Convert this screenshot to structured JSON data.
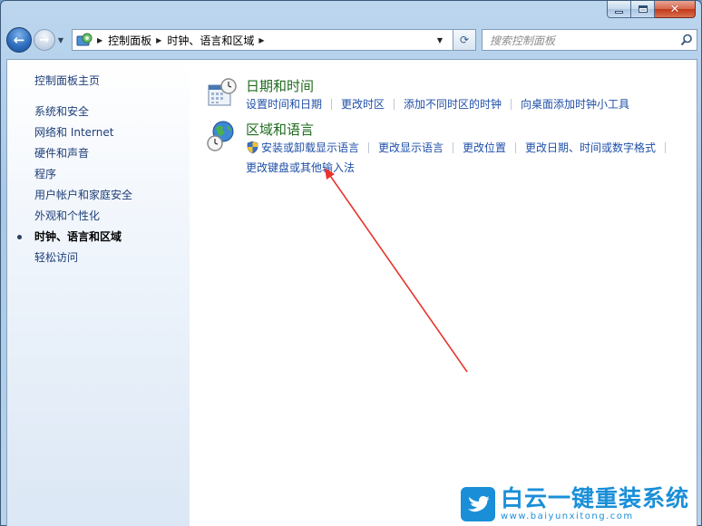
{
  "window": {
    "close_symbol": "✕"
  },
  "nav": {
    "back_arrow": "←",
    "forward_arrow": "→",
    "history_arrow": "▼",
    "breadcrumb_sep": "▶",
    "breadcrumbs": [
      "控制面板",
      "时钟、语言和区域"
    ],
    "dropdown_arrow": "▼",
    "refresh_symbol": "⟳",
    "search_placeholder": "搜索控制面板"
  },
  "sidebar": {
    "home": "控制面板主页",
    "items": [
      {
        "label": "系统和安全",
        "active": false
      },
      {
        "label": "网络和 Internet",
        "active": false
      },
      {
        "label": "硬件和声音",
        "active": false
      },
      {
        "label": "程序",
        "active": false
      },
      {
        "label": "用户帐户和家庭安全",
        "active": false
      },
      {
        "label": "外观和个性化",
        "active": false
      },
      {
        "label": "时钟、语言和区域",
        "active": true
      },
      {
        "label": "轻松访问",
        "active": false
      }
    ]
  },
  "categories": [
    {
      "title": "日期和时间",
      "icon": "calendar-clock-icon",
      "links": [
        "设置时间和日期",
        "更改时区",
        "添加不同时区的时钟",
        "向桌面添加时钟小工具"
      ]
    },
    {
      "title": "区域和语言",
      "icon": "globe-clock-icon",
      "links": [
        "安装或卸载显示语言",
        "更改显示语言",
        "更改位置",
        "更改日期、时间或数字格式"
      ],
      "links_row2": [
        "更改键盘或其他输入法"
      ]
    }
  ],
  "watermark": {
    "title": "白云一键重装系统",
    "url": "www.baiyunxitong.com"
  },
  "colors": {
    "link": "#1f4fa8",
    "category_title": "#1e6b1e",
    "arrow": "#e8332c",
    "watermark": "#1a8fd8"
  }
}
